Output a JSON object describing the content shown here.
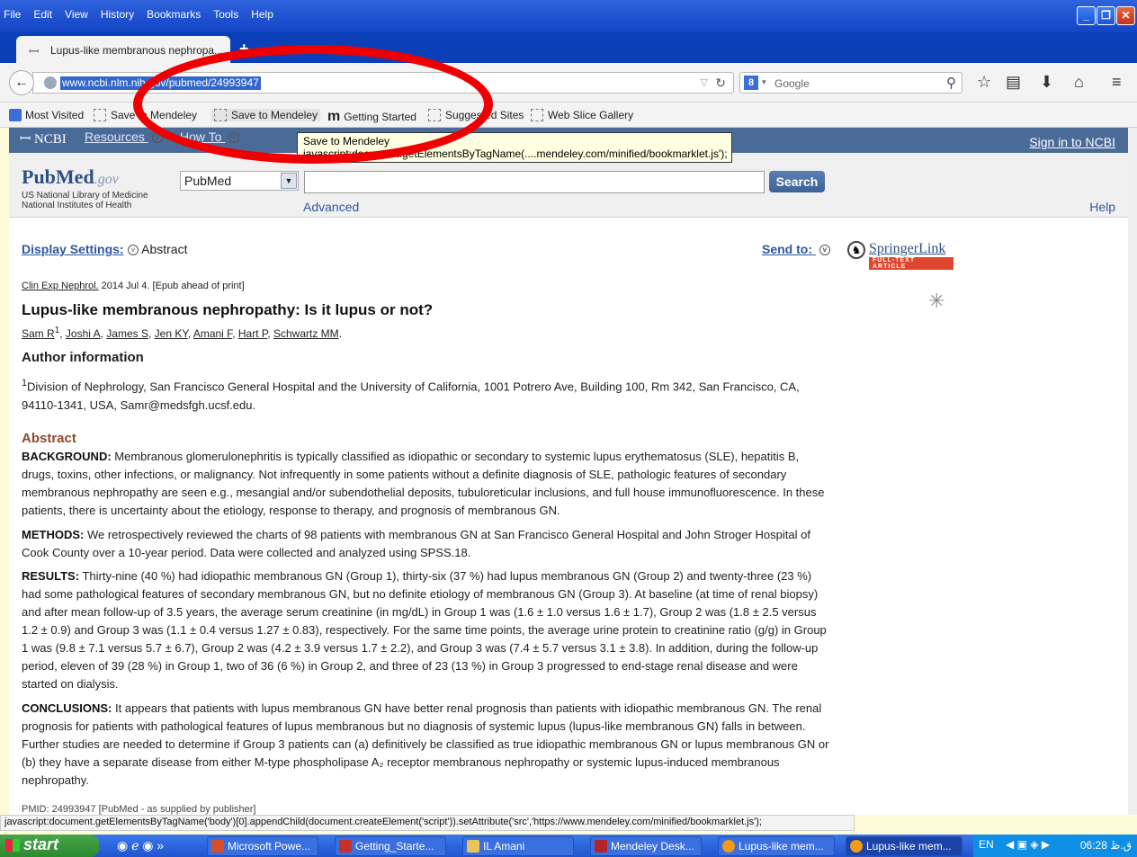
{
  "menu": [
    "File",
    "Edit",
    "View",
    "History",
    "Bookmarks",
    "Tools",
    "Help"
  ],
  "tab": {
    "title": "Lupus-like membranous nephropa...",
    "close": "×",
    "new": "+"
  },
  "nav": {
    "url": "www.ncbi.nlm.nih.gov/pubmed/24993947",
    "search_placeholder": "Google"
  },
  "bookmarks": {
    "most_visited": "Most Visited",
    "save1": "Save to Mendeley",
    "save2": "Save to Mendeley",
    "getting_started": "Getting Started",
    "suggested": "Suggested Sites",
    "webslice": "Web Slice Gallery"
  },
  "tooltip": {
    "line1": "Save to Mendeley",
    "line2": "javascript:document.getElementsByTagName(....mendeley.com/minified/bookmarklet.js');"
  },
  "ncbi": {
    "logo": "NCBI",
    "resources": "Resources",
    "howto": "How To",
    "signin": "Sign in to NCBI"
  },
  "pubmed": {
    "logo_pub": "PubMed",
    "logo_gov": ".gov",
    "sub1": "US National Library of Medicine",
    "sub2": "National Institutes of Health",
    "db": "PubMed",
    "search_btn": "Search",
    "advanced": "Advanced",
    "help": "Help"
  },
  "page": {
    "display_settings": "Display Settings:",
    "abstract_label": "Abstract",
    "send_to": "Send to:",
    "springer": "SpringerLink",
    "springer_sub": "FULL-TEXT ARTICLE",
    "journal": "Clin Exp Nephrol.",
    "citation": " 2014 Jul 4. [Epub ahead of print]",
    "title": "Lupus-like membranous nephropathy: Is it lupus or not?",
    "authors": [
      "Sam R",
      "Joshi A",
      "James S",
      "Jen KY",
      "Amani F",
      "Hart P",
      "Schwartz MM"
    ],
    "author_info": "Author information",
    "affil_sup": "1",
    "affiliation": "Division of Nephrology, San Francisco General Hospital and the University of California, 1001 Potrero Ave, Building 100, Rm 342, San Francisco, CA, 94110-1341, USA, Samr@medsfgh.ucsf.edu.",
    "abstract_heading": "Abstract",
    "background_label": "BACKGROUND:",
    "background": "Membranous glomerulonephritis is typically classified as idiopathic or secondary to systemic lupus erythematosus (SLE), hepatitis B, drugs, toxins, other infections, or malignancy. Not infrequently in some patients without a definite diagnosis of SLE, pathologic features of secondary membranous nephropathy are seen e.g., mesangial and/or subendothelial deposits, tubuloreticular inclusions, and full house immunofluorescence. In these patients, there is uncertainty about the etiology, response to therapy, and prognosis of membranous GN.",
    "methods_label": "METHODS:",
    "methods": "We retrospectively reviewed the charts of 98 patients with membranous GN at San Francisco General Hospital and John Stroger Hospital of Cook County over a 10-year period. Data were collected and analyzed using SPSS.18.",
    "results_label": "RESULTS:",
    "results": "Thirty-nine (40 %) had idiopathic membranous GN (Group 1), thirty-six (37 %) had lupus membranous GN (Group 2) and twenty-three (23 %) had some pathological features of secondary membranous GN, but no definite etiology of membranous GN (Group 3). At baseline (at time of renal biopsy) and after mean follow-up of 3.5 years, the average serum creatinine (in mg/dL) in Group 1 was (1.6 ± 1.0 versus 1.6 ± 1.7), Group 2 was (1.8 ± 2.5 versus 1.2 ± 0.9) and Group 3 was (1.1 ± 0.4 versus 1.27 ± 0.83), respectively. For the same time points, the average urine protein to creatinine ratio (g/g) in Group 1 was (9.8 ± 7.1 versus 5.7 ± 6.7), Group 2 was (4.2 ± 3.9 versus 1.7 ± 2.2), and Group 3 was (7.4 ± 5.7 versus 3.1 ± 3.8). In addition, during the follow-up period, eleven of 39 (28 %) in Group 1, two of 36 (6 %) in Group 2, and three of 23 (13 %) in Group 3 progressed to end-stage renal disease and were started on dialysis.",
    "conclusions_label": "CONCLUSIONS:",
    "conclusions": "It appears that patients with lupus membranous GN have better renal prognosis than patients with idiopathic membranous GN. The renal prognosis for patients with pathological features of lupus membranous but no diagnosis of systemic lupus (lupus-like membranous GN) falls in between. Further studies are needed to determine if Group 3 patients can (a) definitively be classified as true idiopathic membranous GN or lupus membranous GN or (b) they have a separate disease from either M-type phospholipase A₂ receptor membranous nephropathy or systemic lupus-induced membranous nephropathy.",
    "pmid": "PMID: 24993947 [PubMed - as supplied by publisher]"
  },
  "status": "javascript:document.getElementsByTagName('body')[0].appendChild(document.createElement('script')).setAttribute('src','https://www.mendeley.com/minified/bookmarklet.js');",
  "taskbar": {
    "start": "start",
    "items": [
      "Microsoft Powe...",
      "Getting_Starte...",
      "IL Amani",
      "Mendeley Desk...",
      "Lupus-like mem...",
      "Lupus-like mem..."
    ],
    "lang": "EN",
    "clock": "06:28 ق.ظ"
  },
  "colors": {
    "accent": "#ee0000",
    "ncbi_bar": "#4a6b98",
    "link": "#2f57a1",
    "abstract_heading": "#8b4a2b"
  }
}
